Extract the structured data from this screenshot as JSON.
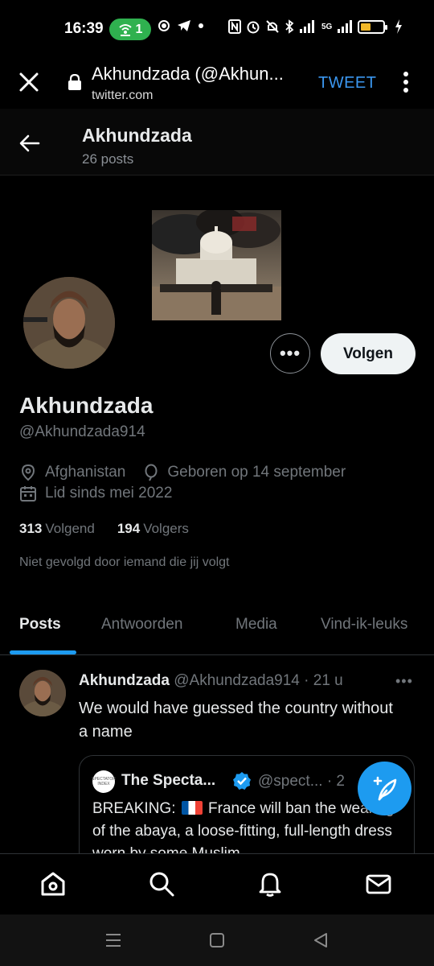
{
  "status_bar": {
    "time": "16:39",
    "hotspot_count": "1",
    "network": "5G"
  },
  "browser": {
    "title": "Akhundzada (@Akhun...",
    "url": "twitter.com",
    "action_label": "TWEET"
  },
  "header": {
    "name": "Akhundzada",
    "posts": "26 posts"
  },
  "profile": {
    "name": "Akhundzada",
    "handle": "@Akhundzada914",
    "location": "Afghanistan",
    "birthday": "Geboren op 14 september",
    "joined": "Lid sinds mei 2022",
    "following_count": "313",
    "following_label": "Volgend",
    "followers_count": "194",
    "followers_label": "Volgers",
    "not_followed": "Niet gevolgd door iemand die jij volgt",
    "follow_label": "Volgen",
    "more_label": "•••"
  },
  "tabs": [
    {
      "label": "Posts",
      "active": true
    },
    {
      "label": "Antwoorden"
    },
    {
      "label": "Media"
    },
    {
      "label": "Vind-ik-leuks"
    }
  ],
  "tweet": {
    "name": "Akhundzada",
    "handle_time": "@Akhundzada914 · 21 u",
    "text": "We would have guessed the country without a name",
    "more_label": "•••",
    "quote": {
      "avatar_text": "SPECTATOR INDEX",
      "name": "The Specta...",
      "handle": "@spect... · 2",
      "text_before": "BREAKING: ",
      "text_after": " France will ban the wearing of the abaya, a loose-fitting, full-length dress worn by some Muslim"
    }
  },
  "colors": {
    "accent": "#1d9bf0",
    "browser_action": "#3b97f0",
    "hotspot": "#2fb14f",
    "battery": "#f2b829"
  }
}
